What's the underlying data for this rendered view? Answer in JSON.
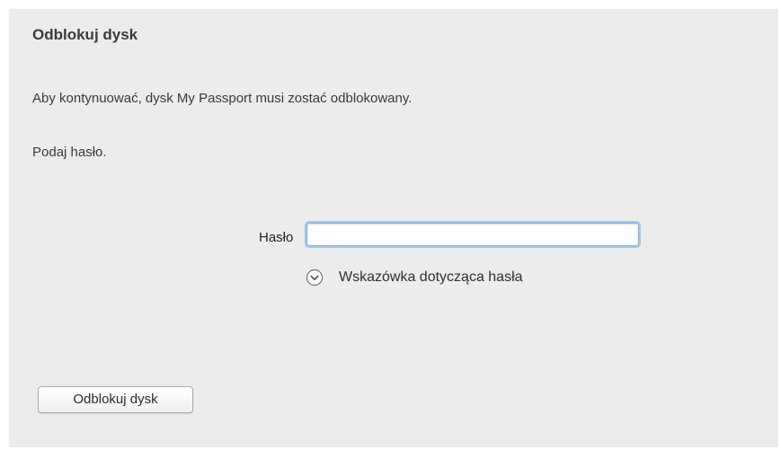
{
  "dialog": {
    "title": "Odblokuj dysk",
    "message": "Aby kontynuować, dysk My Passport musi zostać odblokowany.",
    "prompt": "Podaj hasło.",
    "password": {
      "label": "Hasło",
      "value": "",
      "focused": true
    },
    "hint": {
      "icon": "chevron-down-circle-icon",
      "label": "Wskazówka dotycząca hasła"
    },
    "unlock_button_label": "Odblokuj dysk"
  }
}
